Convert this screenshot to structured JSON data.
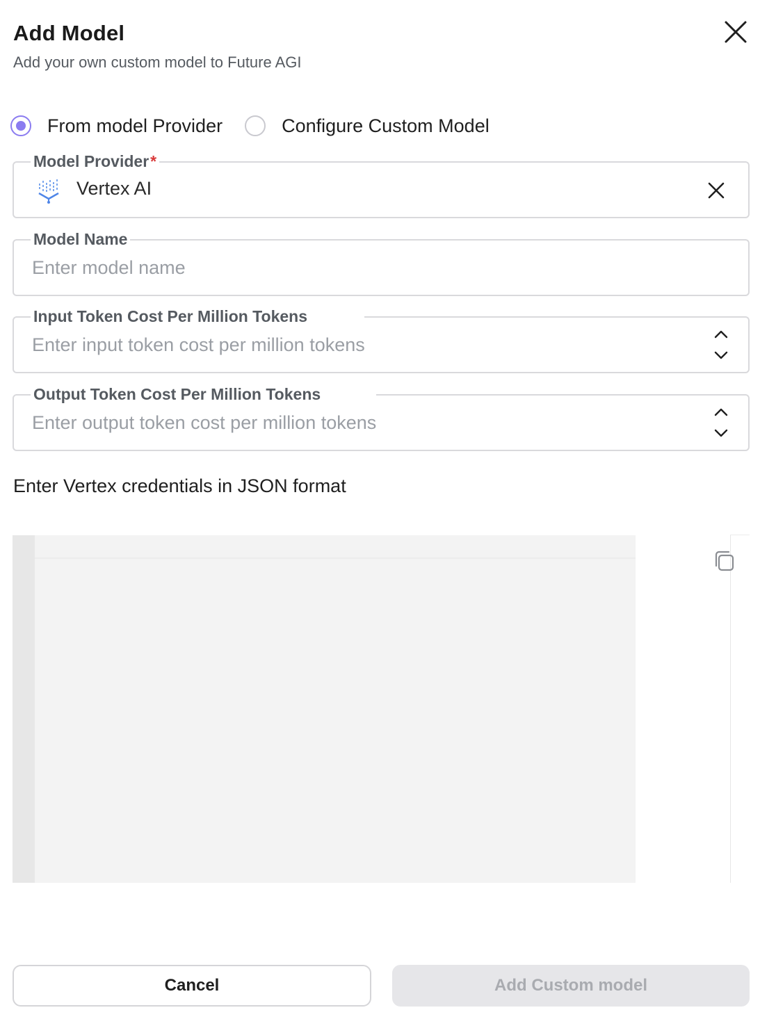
{
  "header": {
    "title": "Add Model",
    "subtitle": "Add your own custom model to Future AGI"
  },
  "mode": {
    "options": [
      {
        "label": "From model Provider",
        "selected": true
      },
      {
        "label": "Configure Custom Model",
        "selected": false
      }
    ]
  },
  "fields": {
    "provider": {
      "label": "Model Provider",
      "required_mark": "*",
      "value": "Vertex AI",
      "icon": "vertex-ai-logo-icon"
    },
    "model_name": {
      "label": "Model Name",
      "placeholder": "Enter model name"
    },
    "input_cost": {
      "label": "Input Token Cost Per Million Tokens",
      "placeholder": "Enter input token cost per million tokens"
    },
    "output_cost": {
      "label": "Output Token Cost Per Million Tokens",
      "placeholder": "Enter output token cost per million tokens"
    }
  },
  "credentials": {
    "prompt": "Enter Vertex credentials in JSON format"
  },
  "footer": {
    "cancel_label": "Cancel",
    "submit_label": "Add Custom model"
  },
  "colors": {
    "accent": "#8b7cf0",
    "required": "#d93a3a",
    "disabled_button_bg": "#e6e6e9"
  }
}
